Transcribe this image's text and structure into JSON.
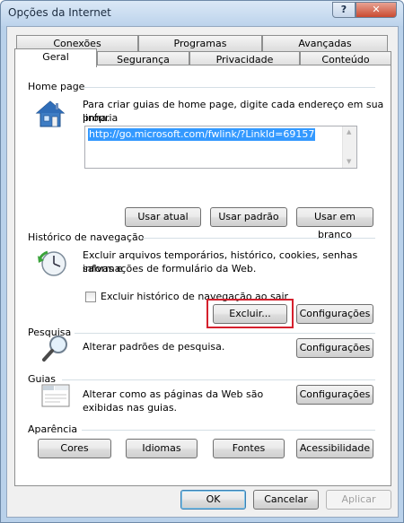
{
  "window": {
    "title": "Opções da Internet",
    "help_label": "?",
    "close_label": "✕"
  },
  "tabs": {
    "row1": [
      "Conexões",
      "Programas",
      "Avançadas"
    ],
    "row2": [
      "Geral",
      "Segurança",
      "Privacidade",
      "Conteúdo"
    ],
    "active": "Geral"
  },
  "home_page": {
    "label": "Home page",
    "description_line1": "Para criar guias de home page, digite cada endereço em sua própria",
    "description_line2": "linha.",
    "url": "http://go.microsoft.com/fwlink/?LinkId=69157",
    "buttons": {
      "current": "Usar atual",
      "default": "Usar padrão",
      "blank": "Usar em branco"
    }
  },
  "history": {
    "label": "Histórico de navegação",
    "description_line1": "Excluir arquivos temporários, histórico, cookies, senhas salvas e",
    "description_line2": "informações de formulário da Web.",
    "checkbox_label": "Excluir histórico de navegação ao sair",
    "checked": false,
    "delete_button": "Excluir...",
    "settings_button": "Configurações"
  },
  "search": {
    "label": "Pesquisa",
    "description": "Alterar padrões de pesquisa.",
    "settings_button": "Configurações"
  },
  "tabs_group": {
    "label": "Guias",
    "description_line1": "Alterar como as páginas da Web são",
    "description_line2": "exibidas nas guias.",
    "settings_button": "Configurações"
  },
  "appearance": {
    "label": "Aparência",
    "buttons": [
      "Cores",
      "Idiomas",
      "Fontes",
      "Acessibilidade"
    ]
  },
  "footer": {
    "ok": "OK",
    "cancel": "Cancelar",
    "apply": "Aplicar"
  },
  "colors": {
    "selection": "#3399ff",
    "highlight_box": "#d5202d"
  }
}
